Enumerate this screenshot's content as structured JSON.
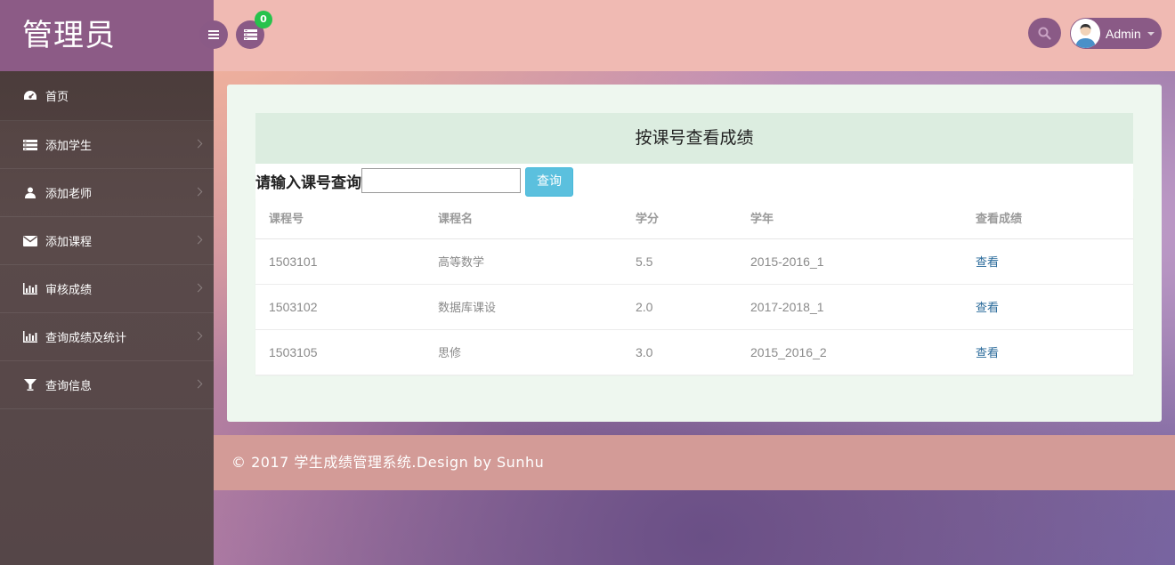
{
  "brand": {
    "title": "管理员"
  },
  "sidebar": {
    "items": [
      {
        "label": "首页",
        "icon": "dashboard-icon"
      },
      {
        "label": "添加学生",
        "icon": "list-icon"
      },
      {
        "label": "添加老师",
        "icon": "user-icon"
      },
      {
        "label": "添加课程",
        "icon": "envelope-icon"
      },
      {
        "label": "审核成绩",
        "icon": "bar-chart-icon"
      },
      {
        "label": "查询成绩及统计",
        "icon": "bar-chart-icon"
      },
      {
        "label": "查询信息",
        "icon": "filter-icon"
      }
    ]
  },
  "topbar": {
    "notification_count": "0",
    "user_name": "Admin"
  },
  "panel": {
    "title": "按课号查看成绩",
    "query_label": "请输入课号查询",
    "query_value": "",
    "query_button": "查询",
    "columns": [
      "课程号",
      "课程名",
      "学分",
      "学年",
      "查看成绩"
    ],
    "rows": [
      {
        "course_id": "1503101",
        "course_name": "高等数学",
        "credit": "5.5",
        "year": "2015-2016_1",
        "action": "查看"
      },
      {
        "course_id": "1503102",
        "course_name": "数据库课设",
        "credit": "2.0",
        "year": "2017-2018_1",
        "action": "查看"
      },
      {
        "course_id": "1503105",
        "course_name": "思修",
        "credit": "3.0",
        "year": "2015_2016_2",
        "action": "查看"
      }
    ]
  },
  "footer": {
    "text": "© 2017 学生成绩管理系统.Design by Sunhu"
  },
  "colors": {
    "brand_bg": "#8c5b86",
    "topbar_bg": "#f0bab3",
    "panel_bg": "#eef7ef",
    "panel_head_bg": "#dcede0",
    "query_button_bg": "#5bc0de",
    "badge_bg": "#27c24c",
    "footer_bg": "#d39b97"
  }
}
